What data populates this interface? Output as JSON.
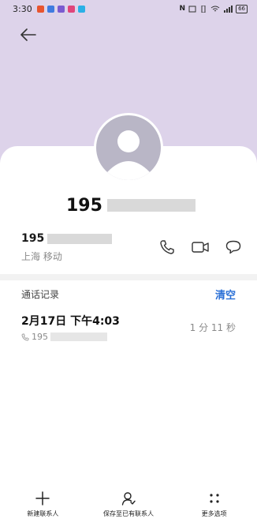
{
  "status_bar": {
    "time": "3:30",
    "right_text": "N",
    "battery": "66"
  },
  "contact": {
    "display_number_prefix": "195"
  },
  "info": {
    "number_prefix": "195",
    "location": "上海 移动"
  },
  "call_log": {
    "title": "通话记录",
    "clear_label": "清空",
    "records": [
      {
        "datetime": "2月17日 下午4:03",
        "number_prefix": "195",
        "duration": "1 分 11 秒"
      }
    ]
  },
  "bottom_actions": [
    {
      "label": "新建联系人",
      "icon": "plus-icon"
    },
    {
      "label": "保存至已有联系人",
      "icon": "person-icon"
    },
    {
      "label": "更多选项",
      "icon": "more-dots-icon"
    }
  ],
  "colors": {
    "header_bg": "#ddd3ea",
    "accent": "#2a6fd6",
    "avatar_bg": "#b9b6c6"
  }
}
